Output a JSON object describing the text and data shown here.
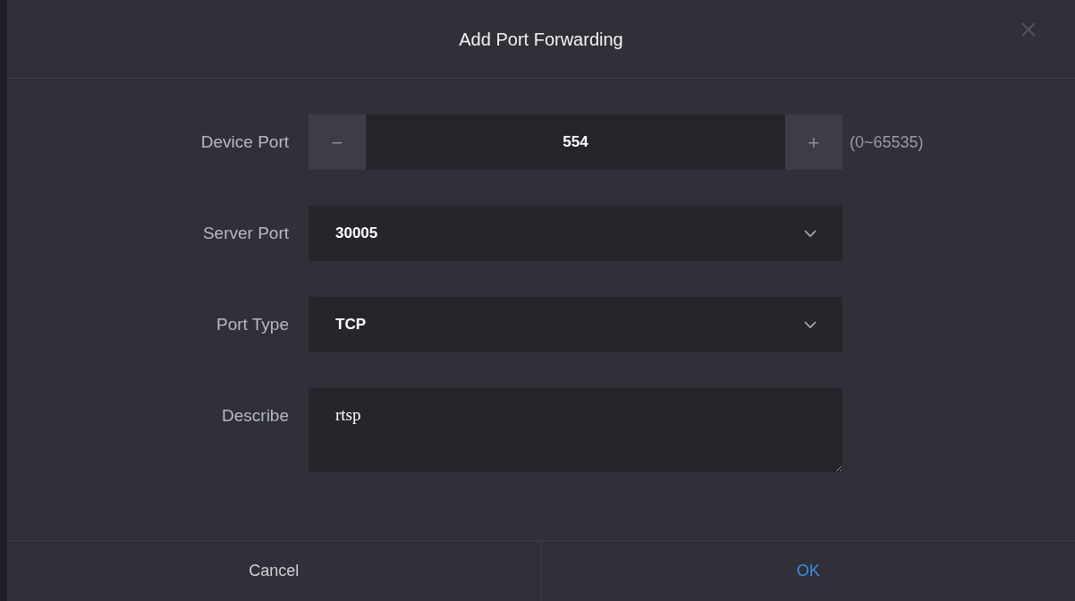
{
  "dialog": {
    "title": "Add Port Forwarding"
  },
  "fields": [
    {
      "kind": "stepper",
      "label": "Device Port",
      "value": "554",
      "decrement": "−",
      "increment": "+",
      "hint": "(0~65535)"
    },
    {
      "kind": "select",
      "label": "Server Port",
      "value": "30005"
    },
    {
      "kind": "select",
      "label": "Port Type",
      "value": "TCP"
    },
    {
      "kind": "textarea",
      "label": "Describe",
      "value": "rtsp"
    }
  ],
  "buttons": [
    {
      "label": "Cancel",
      "primary": false
    },
    {
      "label": "OK",
      "primary": true
    }
  ]
}
